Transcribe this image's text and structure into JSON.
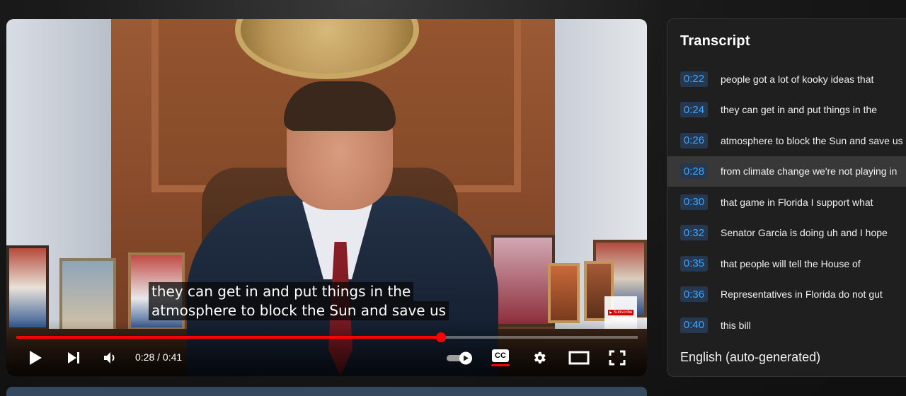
{
  "player": {
    "caption_lines": [
      "they can get in and put things in the",
      "atmosphere to block the Sun and save us"
    ],
    "current_time": "0:28",
    "duration": "0:41",
    "time_display": "0:28 / 0:41",
    "progress_fraction": 0.683,
    "subscribe_label": "Subscribe",
    "controls": {
      "play_icon": "play-icon",
      "next_icon": "skip-next-icon",
      "volume_icon": "volume-icon",
      "autoplay_icon": "autoplay-toggle-icon",
      "captions_label": "CC",
      "settings_icon": "gear-icon",
      "theater_icon": "theater-mode-icon",
      "fullscreen_icon": "fullscreen-icon"
    },
    "accent_color": "#ff0000"
  },
  "transcript": {
    "title": "Transcript",
    "language": "English (auto-generated)",
    "active_index": 3,
    "segments": [
      {
        "time": "0:22",
        "text": "people got a lot of kooky ideas that"
      },
      {
        "time": "0:24",
        "text": "they can get in and put things in the"
      },
      {
        "time": "0:26",
        "text": "atmosphere to block the Sun and save us"
      },
      {
        "time": "0:28",
        "text": "from climate change we're not playing in"
      },
      {
        "time": "0:30",
        "text": "that game in Florida I support what"
      },
      {
        "time": "0:32",
        "text": "Senator Garcia is doing uh and I hope"
      },
      {
        "time": "0:35",
        "text": "that people will tell the House of"
      },
      {
        "time": "0:36",
        "text": "Representatives in Florida do not gut"
      },
      {
        "time": "0:40",
        "text": "this bill"
      }
    ],
    "timestamp_color": "#3ea6ff"
  }
}
